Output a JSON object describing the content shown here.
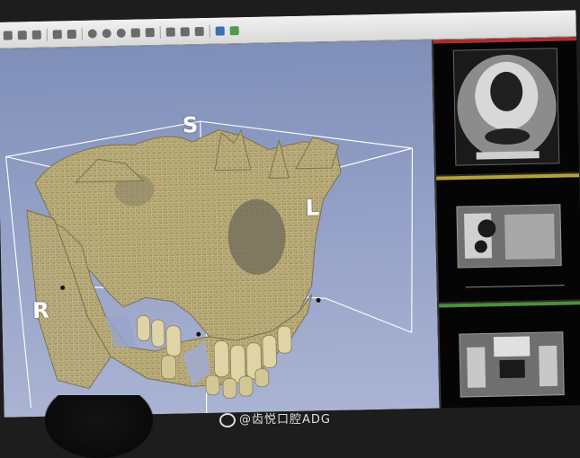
{
  "scene": {
    "description_icons": [
      "toolbar-buttons"
    ],
    "orientation_labels": {
      "superior": "S",
      "left": "L",
      "right": "R"
    },
    "watermark": {
      "text": "@齿悦口腔ADG"
    },
    "colors": {
      "view_background": "#93a0c6",
      "bone": "#b7ab79",
      "panel_axial_bar": "#b02c2c",
      "panel_coronal_bar": "#b5a33a",
      "panel_sagittal_bar": "#4f8f3a"
    }
  }
}
